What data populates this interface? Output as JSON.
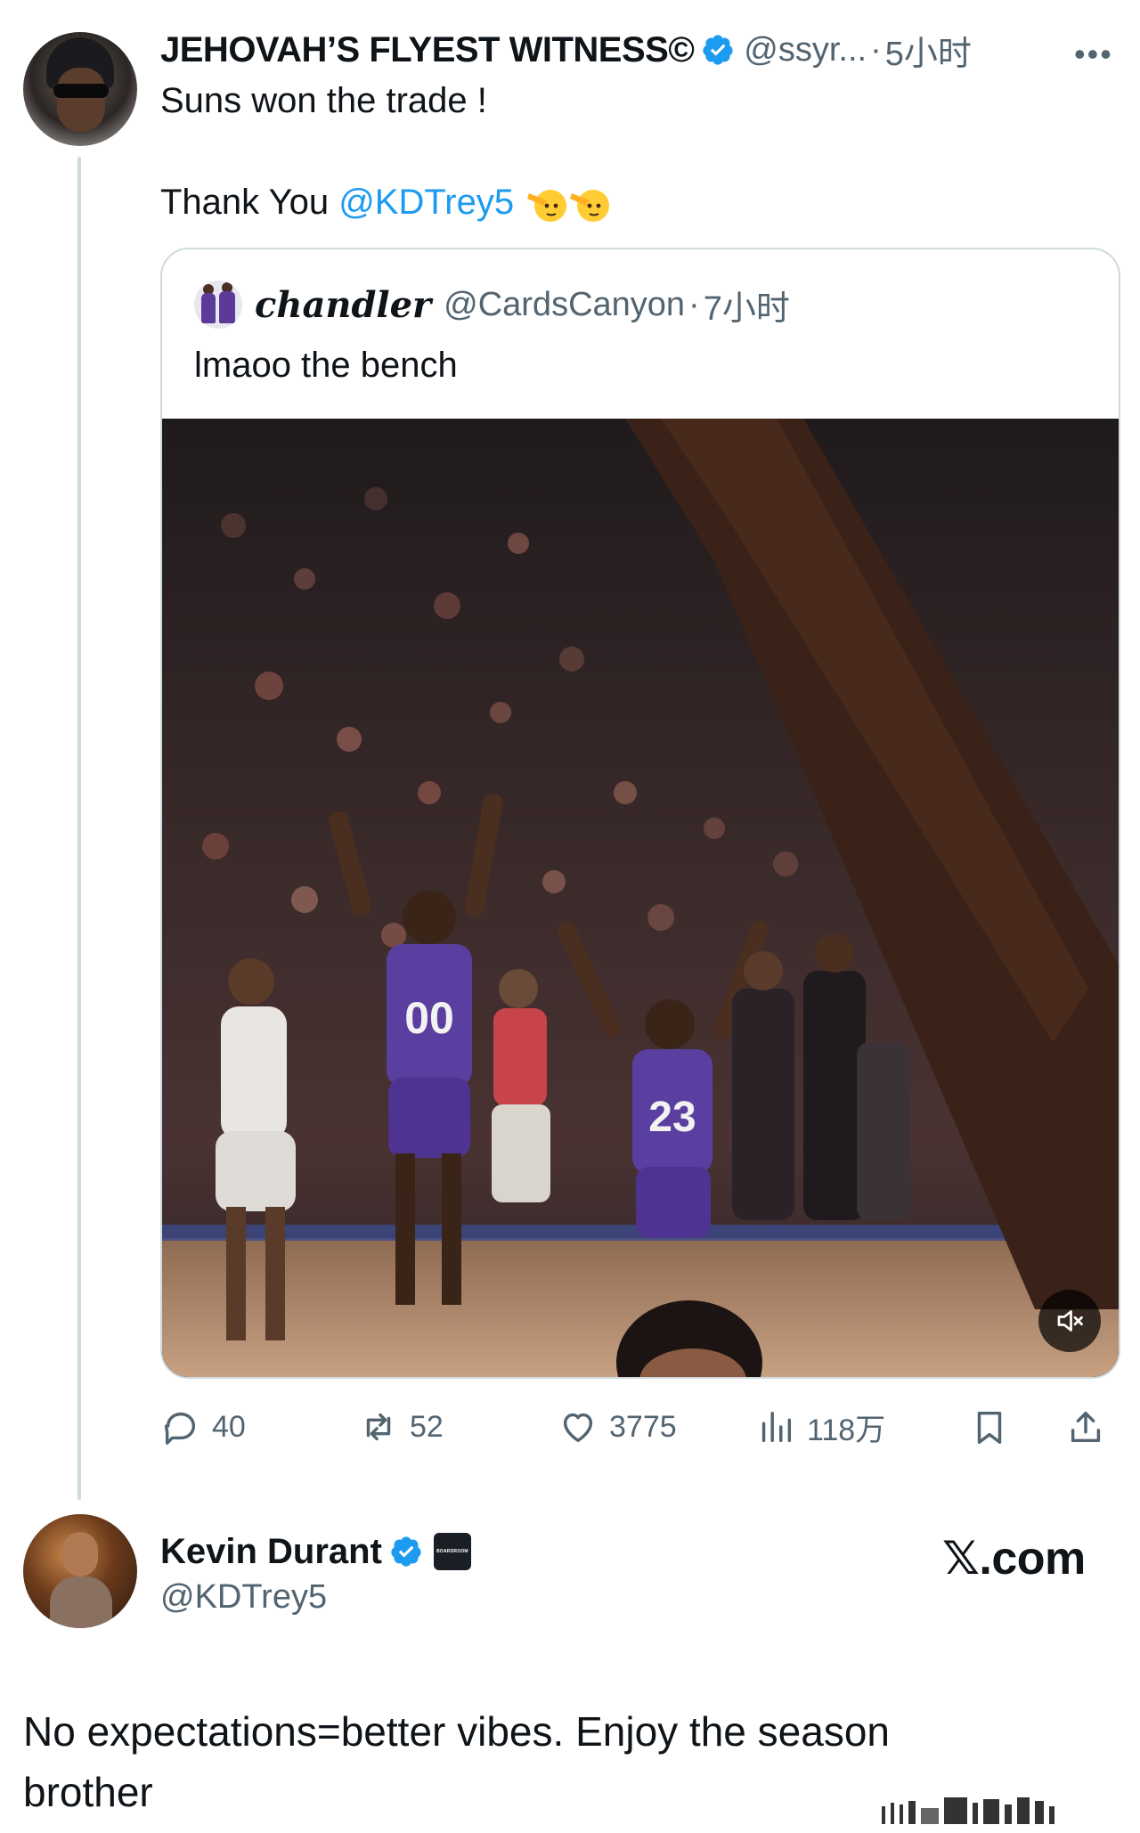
{
  "tweet": {
    "author": {
      "display_name": "JEHOVAH’S FLYEST WITNESS©",
      "handle": "@ssyr...",
      "time": "5小时",
      "separator": "·"
    },
    "text_line1": "Suns won the trade !",
    "text_line2_prefix": "Thank You ",
    "mention": "@KDTrey5",
    "emoji_name": "saluting-face-emoji",
    "quote": {
      "author_name": "chandler",
      "handle": "@CardsCanyon",
      "separator": "·",
      "time": "7小时",
      "text": "lmaoo the bench",
      "media": "video-basketball-bench-celebration"
    },
    "actions": {
      "replies": "40",
      "reposts": "52",
      "likes": "3775",
      "views": "118万"
    }
  },
  "reply": {
    "display_name": "Kevin Durant",
    "handle": "@KDTrey5",
    "badge_text": "BOARDROOM",
    "text": "No expectations=better vibes. Enjoy the season brother"
  },
  "site_mark": "𝕏.com",
  "colors": {
    "accent": "#1d9bf0",
    "secondary_text": "#536471",
    "border": "#cfd9de"
  }
}
